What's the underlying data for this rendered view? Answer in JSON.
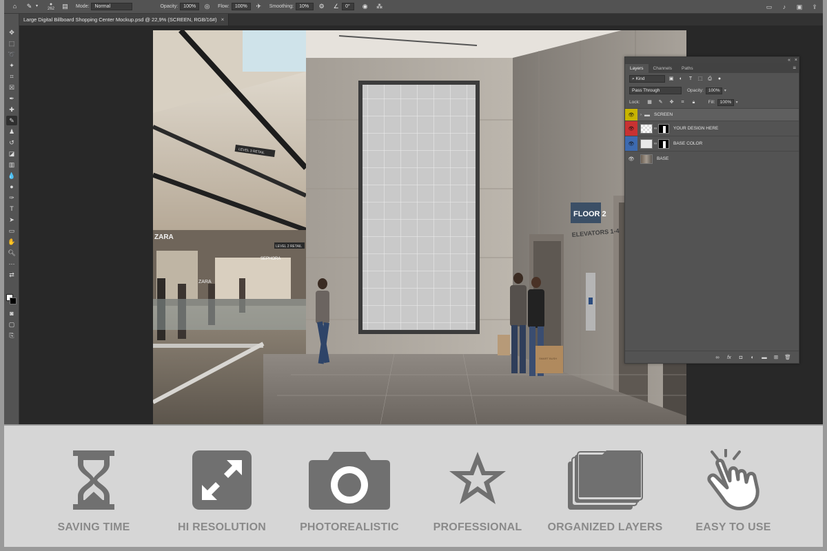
{
  "options_bar": {
    "brush_size": "262",
    "mode_label": "Mode:",
    "mode_value": "Normal",
    "opacity_label": "Opacity:",
    "opacity_value": "100%",
    "flow_label": "Flow:",
    "flow_value": "100%",
    "smoothing_label": "Smoothing:",
    "smoothing_value": "10%",
    "angle_value": "0°"
  },
  "document_tab": {
    "title": "Large Digital Billboard Shopping Center Mockup.psd @ 22,9% (SCREEN, RGB/16#)",
    "close": "×"
  },
  "canvas_signs": {
    "floor": "FLOOR 2",
    "elevators": "ELEVATORS 1-4",
    "level3": "LEVEL 3 RETAIL",
    "level2": "LEVEL 2 RETAIL",
    "store1": "ZARA",
    "store2": "SEPHORA",
    "store3": "ZARA",
    "bag": "SMART BUSH"
  },
  "layers_panel": {
    "tabs": [
      "Layers",
      "Channels",
      "Paths"
    ],
    "filter_kind": "Kind",
    "blend_mode": "Pass Through",
    "opacity_label": "Opacity:",
    "opacity_value": "100%",
    "lock_label": "Lock:",
    "fill_label": "Fill:",
    "fill_value": "100%",
    "layers": [
      {
        "name": "SCREEN",
        "eye_color": "#c8b400"
      },
      {
        "name": "YOUR DESIGN HERE",
        "eye_color": "#c83232"
      },
      {
        "name": "BASE COLOR",
        "eye_color": "#3d6ab0"
      },
      {
        "name": "BASE",
        "eye_color": "#535353"
      }
    ]
  },
  "features": [
    {
      "label": "SAVING TIME",
      "icon": "hourglass-icon"
    },
    {
      "label": "HI RESOLUTION",
      "icon": "expand-icon"
    },
    {
      "label": "PHOTOREALISTIC",
      "icon": "camera-icon"
    },
    {
      "label": "PROFESSIONAL",
      "icon": "star-icon"
    },
    {
      "label": "ORGANIZED LAYERS",
      "icon": "folders-icon"
    },
    {
      "label": "EASY TO USE",
      "icon": "click-hand-icon"
    }
  ],
  "colors": {
    "feature_icon": "#707070",
    "feature_label": "#8a8a8a",
    "ps_dark": "#282828",
    "ps_panel": "#535353"
  }
}
